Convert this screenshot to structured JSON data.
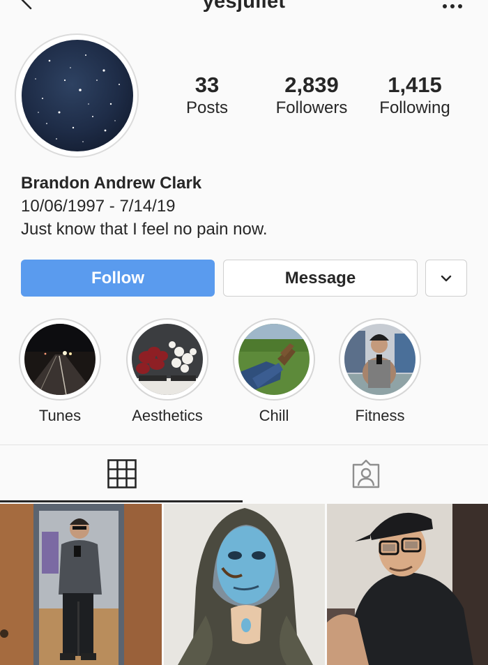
{
  "header": {
    "username": "yesjuliet",
    "back_icon": "chevron-left-icon",
    "more_icon": "more-dots-icon"
  },
  "profile": {
    "avatar": "starry-night-sky",
    "stats": {
      "posts": {
        "value": "33",
        "label": "Posts"
      },
      "followers": {
        "value": "2,839",
        "label": "Followers"
      },
      "following": {
        "value": "1,415",
        "label": "Following"
      }
    },
    "bio": {
      "name": "Brandon Andrew Clark",
      "line1": "10/06/1997 - 7/14/19",
      "line2": "Just know that I feel no pain now."
    }
  },
  "actions": {
    "follow_label": "Follow",
    "message_label": "Message",
    "more_icon": "chevron-down-icon"
  },
  "highlights": [
    {
      "label": "Tunes"
    },
    {
      "label": "Aesthetics"
    },
    {
      "label": "Chill"
    },
    {
      "label": "Fitness"
    }
  ],
  "tabs": [
    {
      "icon": "grid-icon",
      "active": true
    },
    {
      "icon": "tagged-person-icon",
      "active": false
    }
  ],
  "colors": {
    "accent": "#5a9bee",
    "text": "#262626",
    "background": "#fafafa",
    "border": "#dbdbdb"
  }
}
